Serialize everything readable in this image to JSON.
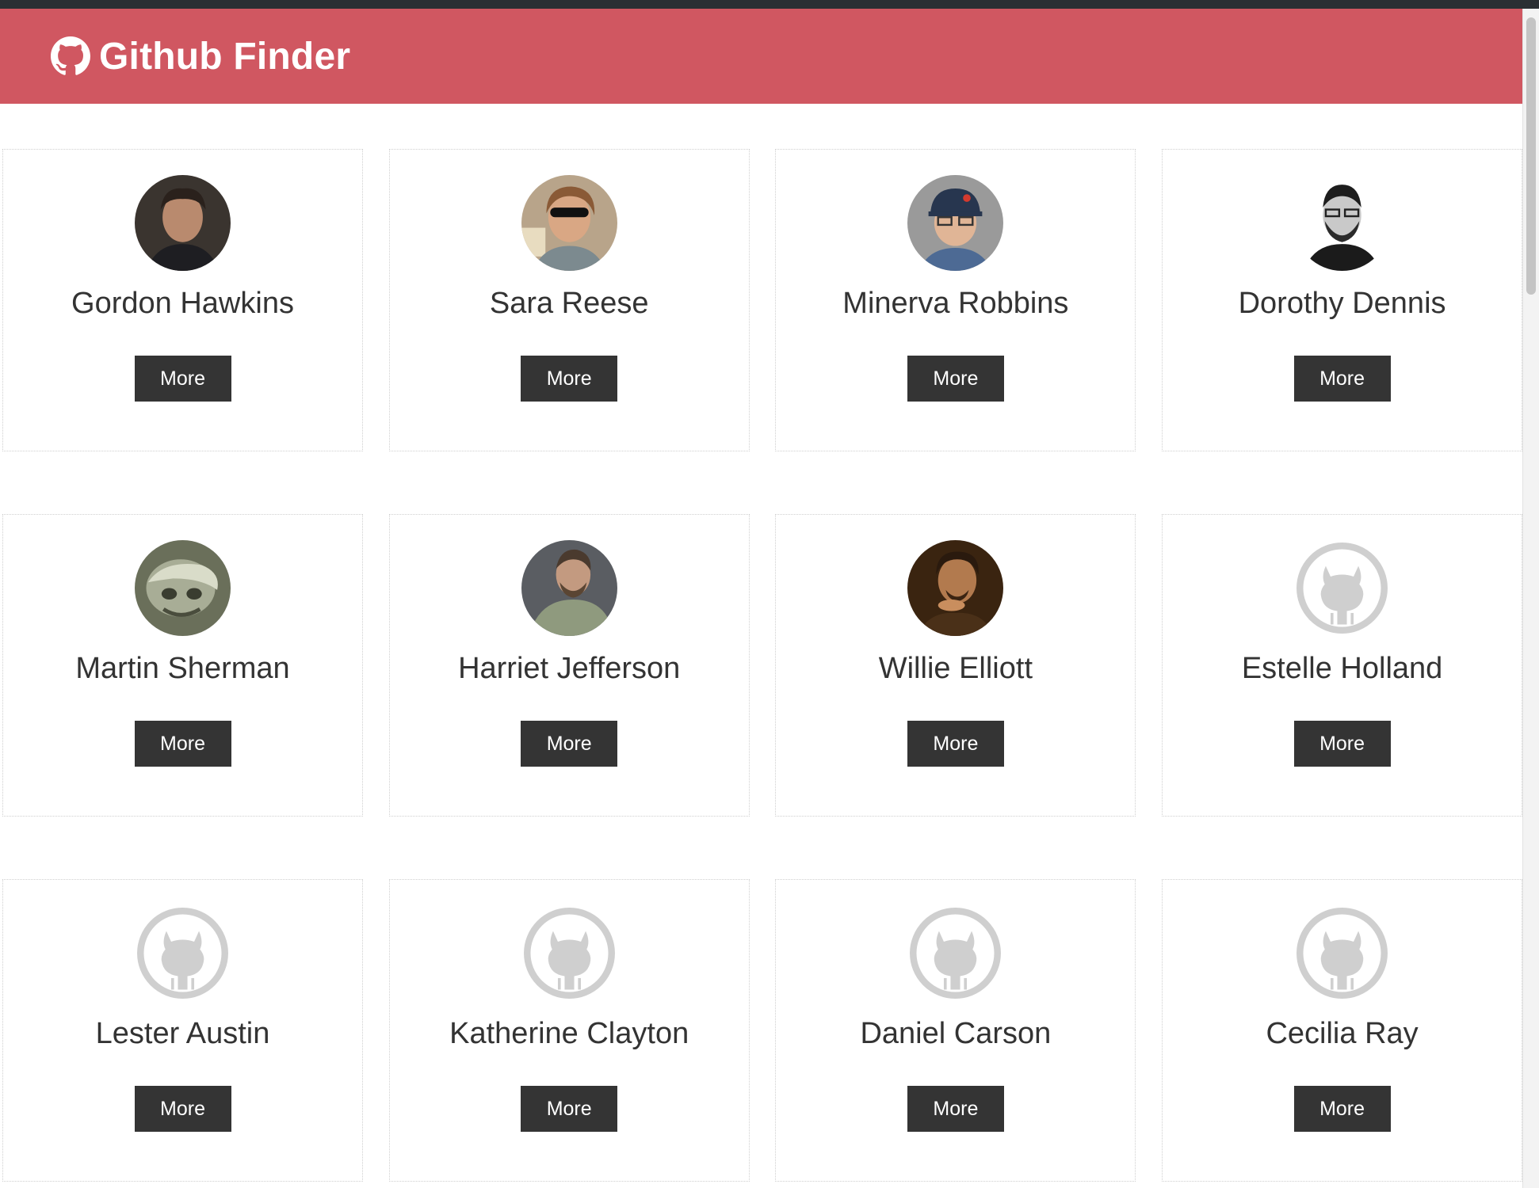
{
  "app": {
    "title": "Github Finder",
    "brand_icon": "github-icon",
    "navbar_color": "#d05761",
    "button_color": "#343434"
  },
  "users": [
    {
      "name": "Gordon Hawkins",
      "more_label": "More",
      "avatar": "photo"
    },
    {
      "name": "Sara Reese",
      "more_label": "More",
      "avatar": "photo"
    },
    {
      "name": "Minerva Robbins",
      "more_label": "More",
      "avatar": "photo"
    },
    {
      "name": "Dorothy Dennis",
      "more_label": "More",
      "avatar": "photo"
    },
    {
      "name": "Martin Sherman",
      "more_label": "More",
      "avatar": "photo"
    },
    {
      "name": "Harriet Jefferson",
      "more_label": "More",
      "avatar": "photo"
    },
    {
      "name": "Willie Elliott",
      "more_label": "More",
      "avatar": "photo"
    },
    {
      "name": "Estelle Holland",
      "more_label": "More",
      "avatar": "default-github-avatar"
    },
    {
      "name": "Lester Austin",
      "more_label": "More",
      "avatar": "default-github-avatar"
    },
    {
      "name": "Katherine Clayton",
      "more_label": "More",
      "avatar": "default-github-avatar"
    },
    {
      "name": "Daniel Carson",
      "more_label": "More",
      "avatar": "default-github-avatar"
    },
    {
      "name": "Cecilia Ray",
      "more_label": "More",
      "avatar": "default-github-avatar"
    }
  ]
}
